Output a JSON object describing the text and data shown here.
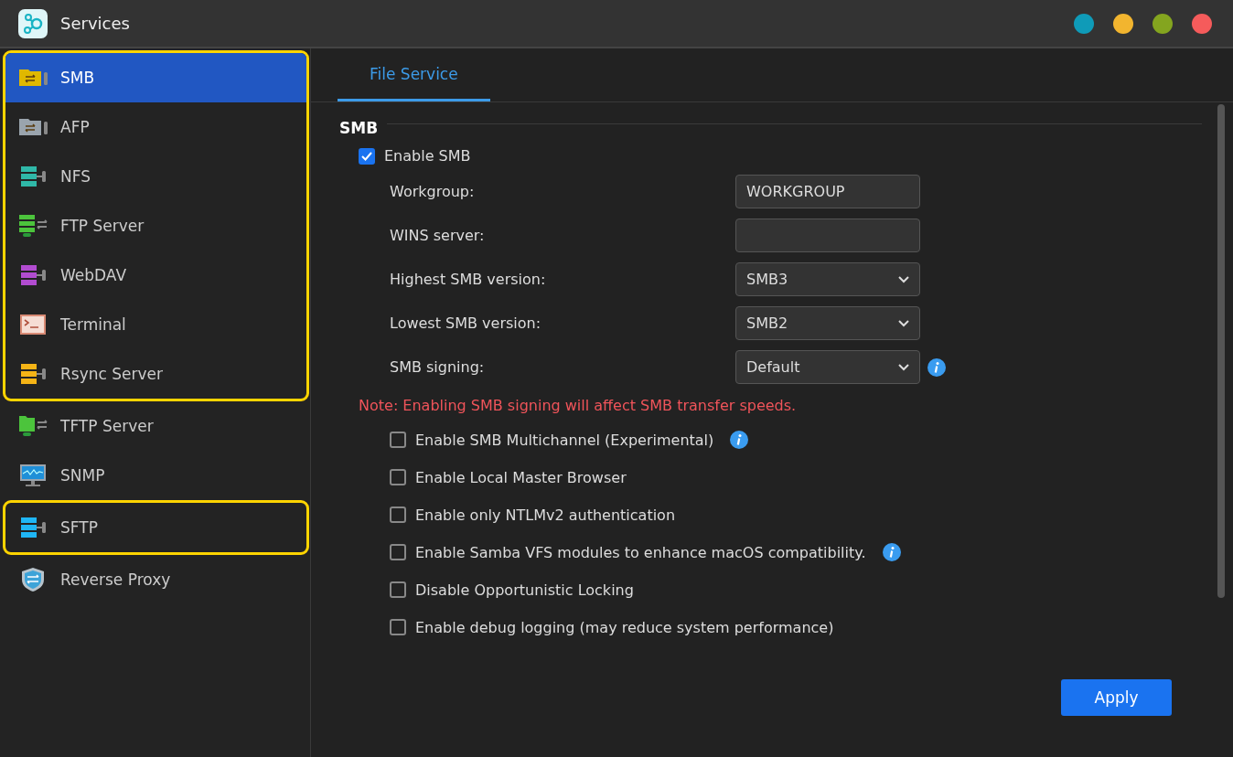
{
  "window": {
    "title": "Services",
    "dots": [
      {
        "color": "#0f9bb8"
      },
      {
        "color": "#f2b52f"
      },
      {
        "color": "#84a51f"
      },
      {
        "color": "#f55b5b"
      }
    ]
  },
  "sidebar": {
    "sections": [
      {
        "highlighted": true,
        "items": [
          {
            "label": "SMB",
            "kind": "folder",
            "color": "#e0b800",
            "selected": true
          },
          {
            "label": "AFP",
            "kind": "folder",
            "color": "#9aa4ad",
            "selected": false
          },
          {
            "label": "NFS",
            "kind": "stack",
            "color": "#2fb8a8",
            "selected": false
          },
          {
            "label": "FTP Server",
            "kind": "ftp",
            "color": "#4cc43c",
            "selected": false
          },
          {
            "label": "WebDAV",
            "kind": "stack",
            "color": "#b24cd0",
            "selected": false
          },
          {
            "label": "Terminal",
            "kind": "terminal",
            "color": "#d98a74",
            "selected": false
          },
          {
            "label": "Rsync Server",
            "kind": "stack",
            "color": "#f5b416",
            "selected": false
          }
        ]
      },
      {
        "highlighted": false,
        "items": [
          {
            "label": "TFTP Server",
            "kind": "tftp",
            "color": "#4cc43c",
            "selected": false
          },
          {
            "label": "SNMP",
            "kind": "monitor",
            "color": "#1f8fd8",
            "selected": false
          }
        ]
      },
      {
        "highlighted": true,
        "items": [
          {
            "label": "SFTP",
            "kind": "stack",
            "color": "#1fb6f5",
            "selected": false
          }
        ]
      },
      {
        "highlighted": false,
        "items": [
          {
            "label": "Reverse Proxy",
            "kind": "shield",
            "color": "#3da3d8",
            "selected": false
          }
        ]
      }
    ]
  },
  "tabs": [
    {
      "label": "File Service",
      "selected": true
    }
  ],
  "section": {
    "title": "SMB",
    "enable": {
      "label": "Enable SMB",
      "checked": true
    },
    "fields": [
      {
        "label": "Workgroup:",
        "kind": "text",
        "value": "WORKGROUP",
        "info": false
      },
      {
        "label": "WINS server:",
        "kind": "text",
        "info": false
      },
      {
        "label": "Highest SMB version:",
        "kind": "select",
        "value": "SMB3",
        "info": false
      },
      {
        "label": "Lowest SMB version:",
        "kind": "select",
        "value": "SMB2",
        "info": false
      },
      {
        "label": "SMB signing:",
        "kind": "select",
        "value": "Default",
        "info": true
      }
    ],
    "note": "Note: Enabling SMB signing will affect SMB transfer speeds.",
    "options": [
      {
        "label": "Enable SMB Multichannel (Experimental)",
        "checked": false,
        "info": true
      },
      {
        "label": "Enable Local Master Browser",
        "checked": false,
        "info": false
      },
      {
        "label": "Enable only NTLMv2 authentication",
        "checked": false,
        "info": false
      },
      {
        "label": "Enable Samba VFS modules to enhance macOS compatibility.",
        "checked": false,
        "info": true
      },
      {
        "label": "Disable Opportunistic Locking",
        "checked": false,
        "info": false
      },
      {
        "label": "Enable debug logging (may reduce system performance)",
        "checked": false,
        "info": false
      }
    ]
  },
  "apply_button": "Apply"
}
